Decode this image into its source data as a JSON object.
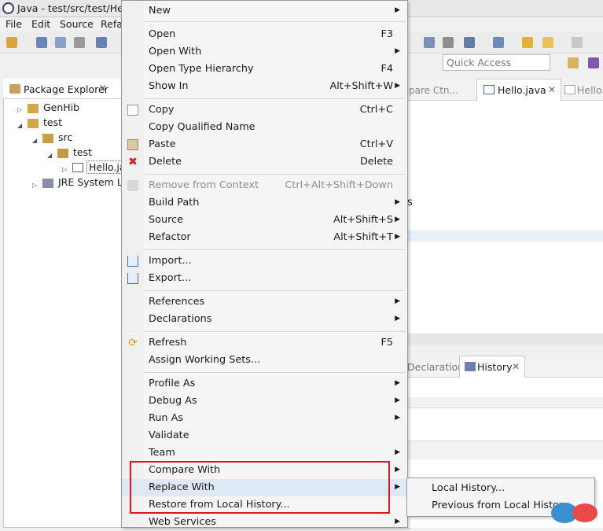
{
  "window": {
    "title": "Java - test/src/test/Hello"
  },
  "menubar": {
    "items": [
      "File",
      "Edit",
      "Source",
      "Refa"
    ]
  },
  "quick_access": {
    "placeholder": "Quick Access"
  },
  "package_explorer": {
    "title": "Package Explorer",
    "tree": [
      {
        "label": "GenHib"
      },
      {
        "label": "test"
      },
      {
        "label": "src"
      },
      {
        "label": "test"
      },
      {
        "label": "Hello.ja"
      },
      {
        "label": "JRE System Lib"
      }
    ]
  },
  "editor_tabs": [
    "pare Ctn...",
    "Hello.java",
    "Hello.ja"
  ],
  "editor_fragment": "s",
  "bottom_tabs": [
    "Declaration",
    "History"
  ],
  "context_menu": {
    "items": [
      {
        "label": "New",
        "shortcut": "",
        "submenu": true
      },
      {
        "label": "Open",
        "shortcut": "F3"
      },
      {
        "label": "Open With",
        "shortcut": "",
        "submenu": true
      },
      {
        "label": "Open Type Hierarchy",
        "shortcut": "F4"
      },
      {
        "label": "Show In",
        "shortcut": "Alt+Shift+W",
        "submenu": true
      },
      {
        "label": "Copy",
        "shortcut": "Ctrl+C",
        "icon": "copy-icon"
      },
      {
        "label": "Copy Qualified Name",
        "shortcut": ""
      },
      {
        "label": "Paste",
        "shortcut": "Ctrl+V",
        "icon": "paste-icon"
      },
      {
        "label": "Delete",
        "shortcut": "Delete",
        "icon": "delete-icon"
      },
      {
        "label": "Remove from Context",
        "shortcut": "Ctrl+Alt+Shift+Down",
        "disabled": true
      },
      {
        "label": "Build Path",
        "shortcut": "",
        "submenu": true
      },
      {
        "label": "Source",
        "shortcut": "Alt+Shift+S",
        "submenu": true
      },
      {
        "label": "Refactor",
        "shortcut": "Alt+Shift+T",
        "submenu": true
      },
      {
        "label": "Import...",
        "shortcut": "",
        "icon": "import-icon"
      },
      {
        "label": "Export...",
        "shortcut": "",
        "icon": "export-icon"
      },
      {
        "label": "References",
        "shortcut": "",
        "submenu": true
      },
      {
        "label": "Declarations",
        "shortcut": "",
        "submenu": true
      },
      {
        "label": "Refresh",
        "shortcut": "F5",
        "icon": "refresh-icon"
      },
      {
        "label": "Assign Working Sets...",
        "shortcut": ""
      },
      {
        "label": "Profile As",
        "shortcut": "",
        "submenu": true
      },
      {
        "label": "Debug As",
        "shortcut": "",
        "submenu": true
      },
      {
        "label": "Run As",
        "shortcut": "",
        "submenu": true
      },
      {
        "label": "Validate",
        "shortcut": ""
      },
      {
        "label": "Team",
        "shortcut": "",
        "submenu": true
      },
      {
        "label": "Compare With",
        "shortcut": "",
        "submenu": true
      },
      {
        "label": "Replace With",
        "shortcut": "",
        "submenu": true,
        "highlighted": true
      },
      {
        "label": "Restore from Local History...",
        "shortcut": ""
      },
      {
        "label": "Web Services",
        "shortcut": "",
        "submenu": true
      }
    ]
  },
  "submenu": {
    "items": [
      "Local History...",
      "Previous from Local History"
    ]
  },
  "colors": {
    "highlight_box": "#e0141e",
    "selection": "#dfe9f5"
  }
}
